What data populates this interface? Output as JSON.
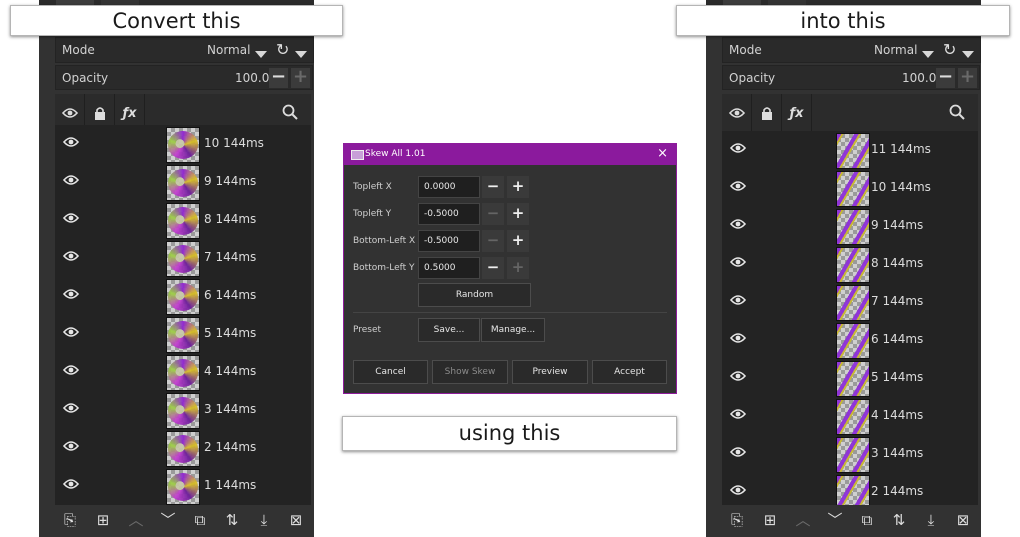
{
  "callouts": {
    "left": "Convert this",
    "right": "into this",
    "middle": "using this"
  },
  "layers_panel": {
    "mode_label": "Mode",
    "mode_value": "Normal",
    "opacity_label": "Opacity",
    "opacity_value": "100.0",
    "header_icons": [
      "eye-icon",
      "lock-icon",
      "fx-icon",
      "search-icon"
    ],
    "bottom_icons": [
      "new-layer-icon",
      "new-group-icon",
      "move-up-icon",
      "move-down-icon",
      "duplicate-icon",
      "sort-icon",
      "merge-down-icon",
      "delete-icon"
    ]
  },
  "before_layers": [
    "10 144ms",
    "9 144ms",
    "8 144ms",
    "7 144ms",
    "6 144ms",
    "5 144ms",
    "4 144ms",
    "3 144ms",
    "2 144ms",
    "1 144ms"
  ],
  "after_layers": [
    "11 144ms",
    "10 144ms",
    "9 144ms",
    "8 144ms",
    "7 144ms",
    "6 144ms",
    "5 144ms",
    "4 144ms",
    "3 144ms",
    "2 144ms"
  ],
  "dialog": {
    "title": "Skew All 1.01",
    "close": "×",
    "fields": [
      {
        "label": "Topleft X",
        "value": "0.0000"
      },
      {
        "label": "Topleft Y",
        "value": "-0.5000"
      },
      {
        "label": "Bottom-Left X",
        "value": "-0.5000"
      },
      {
        "label": "Bottom-Left Y",
        "value": "0.5000"
      }
    ],
    "random_label": "Random",
    "preset_label": "Preset",
    "save_label": "Save...",
    "manage_label": "Manage...",
    "cancel_label": "Cancel",
    "show_skew_label": "Show Skew",
    "preview_label": "Preview",
    "accept_label": "Accept"
  },
  "colors": {
    "accent": "#8b1a9d",
    "panel_bg": "#323232",
    "list_bg": "#232323"
  }
}
